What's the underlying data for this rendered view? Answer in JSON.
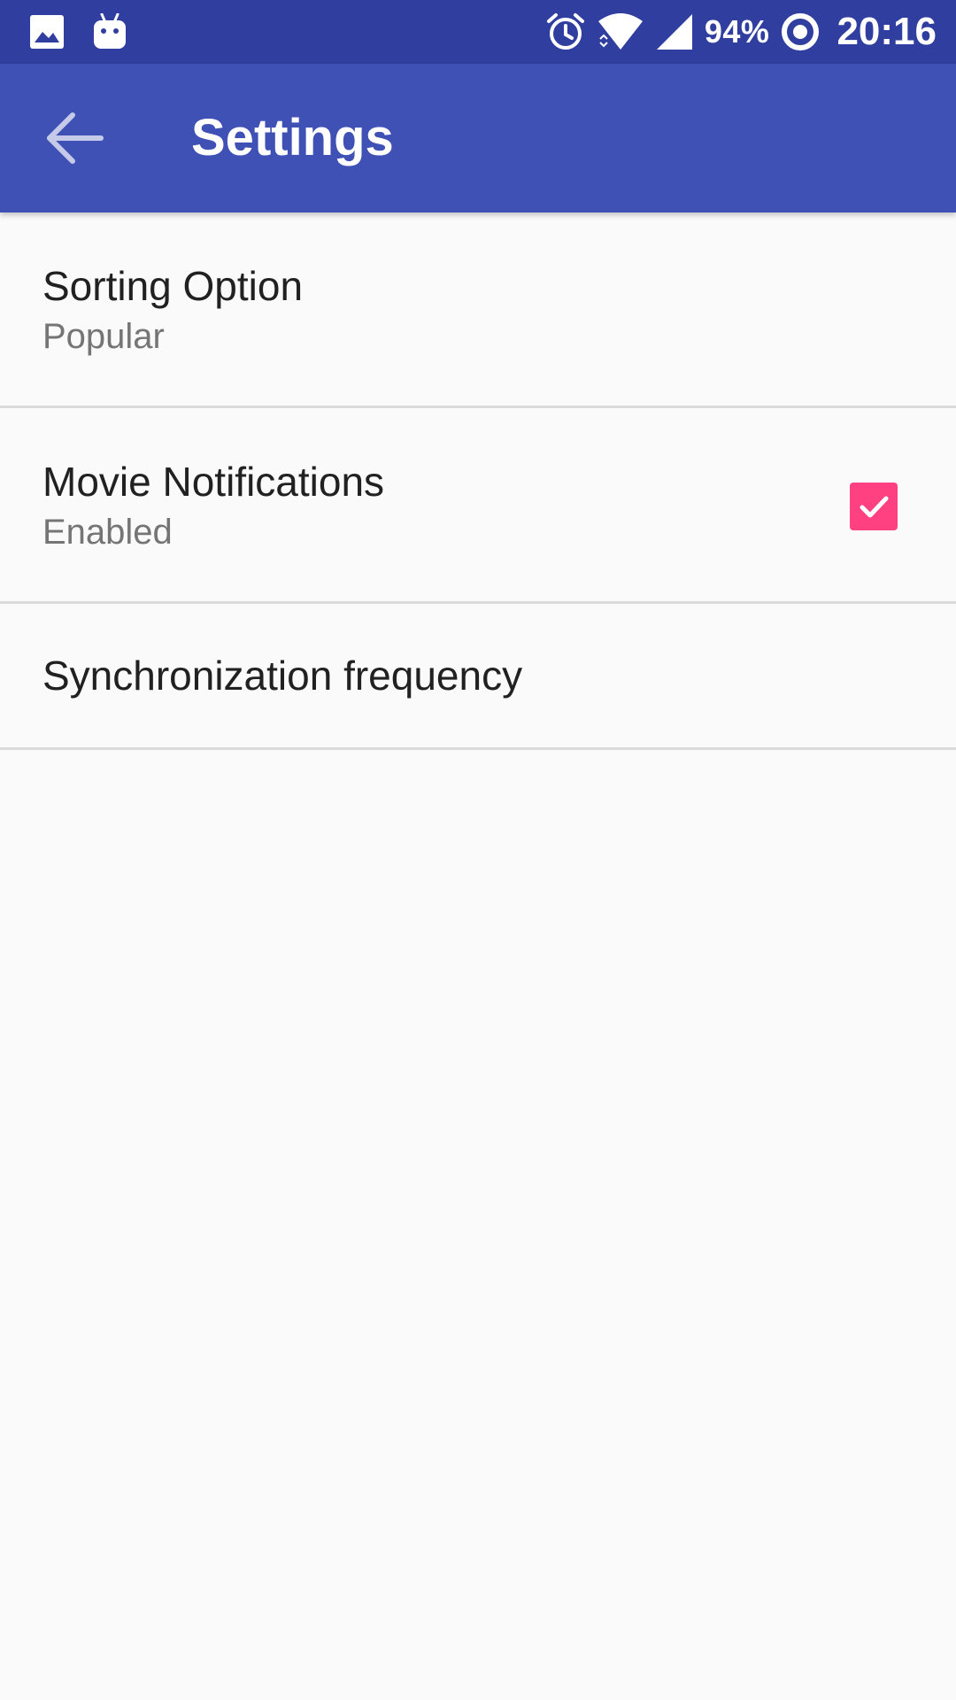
{
  "status_bar": {
    "battery_percent": "94%",
    "time": "20:16",
    "left_icons": [
      "image-notification-icon",
      "android-debug-icon"
    ],
    "right_icons": [
      "alarm-icon",
      "wifi-icon",
      "cell-signal-icon",
      "battery-ring-icon"
    ]
  },
  "app_bar": {
    "title": "Settings",
    "back_icon": "arrow-back-icon"
  },
  "preferences": [
    {
      "title": "Sorting Option",
      "summary": "Popular"
    },
    {
      "title": "Movie Notifications",
      "summary": "Enabled",
      "checked": true
    },
    {
      "title": "Synchronization frequency"
    }
  ],
  "colors": {
    "status_bar": "#303f9f",
    "app_bar": "#3f51b5",
    "accent": "#ff4081",
    "background": "#fafafa",
    "divider": "#dadada"
  }
}
